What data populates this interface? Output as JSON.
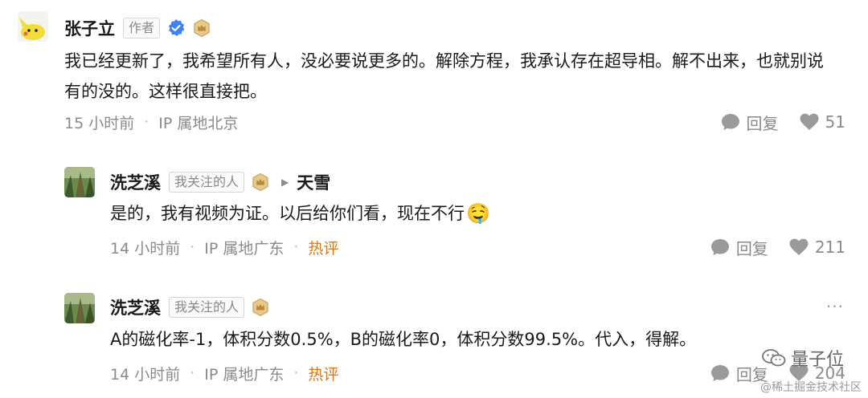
{
  "comments": [
    {
      "username": "张子立",
      "author_tag": "作者",
      "verified_icon": "verified-badge-icon",
      "level_icon": "crown-badge-icon",
      "text": "我已经更新了，我希望所有人，没必要说更多的。解除方程，我承认存在超导相。解不出来，也就别说有的没的。这样很直接把。",
      "time": "15 小时前",
      "location": "IP 属地北京",
      "reply_label": "回复",
      "likes": "51"
    },
    {
      "username": "洗芝溪",
      "tag": "我关注的人",
      "level_icon": "crown-badge-icon",
      "reply_to": "天雪",
      "text": "是的，我有视频为证。以后给你们看，现在不行",
      "emoji": "🤤",
      "time": "14 小时前",
      "location": "IP 属地广东",
      "hot_label": "热评",
      "reply_label": "回复",
      "likes": "211"
    },
    {
      "username": "洗芝溪",
      "tag": "我关注的人",
      "level_icon": "crown-badge-icon",
      "text": "A的磁化率-1，体积分数0.5%，B的磁化率0，体积分数99.5%。代入，得解。",
      "time": "14 小时前",
      "location": "IP 属地广东",
      "hot_label": "热评",
      "reply_label": "回复",
      "likes": "204",
      "more": "···"
    }
  ],
  "watermark": {
    "brand": "量子位",
    "community": "@稀土掘金技术社区"
  },
  "colors": {
    "hot": "#e0781b",
    "verified": "#3b82f6",
    "crown": "#c9a25a",
    "meta": "#8a8a8a"
  }
}
